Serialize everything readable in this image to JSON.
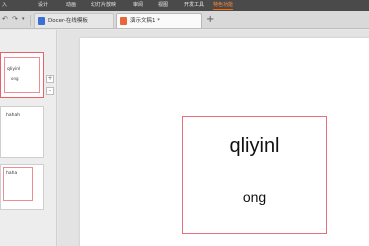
{
  "menu": {
    "items": [
      "入",
      "设计",
      "动画",
      "幻灯片放映",
      "审阅",
      "视图",
      "开发工具",
      "特色功能"
    ],
    "active_index": 7
  },
  "quick_access": [
    "undo-icon",
    "redo-icon",
    "dropdown-icon"
  ],
  "tabs": [
    {
      "label": "Docer-在线模板",
      "icon": "docer-icon",
      "icon_color": "#3b6fd6",
      "active": false
    },
    {
      "label": "演示文稿1 *",
      "icon": "presentation-icon",
      "icon_color": "#e8673a",
      "active": true
    }
  ],
  "tab_add_label": "+",
  "pane": {
    "tab_label": "",
    "slides": [
      {
        "title": "qliyinl",
        "subtitle": "ong",
        "selected": true
      },
      {
        "title": "hahah",
        "subtitle": "",
        "selected": false
      },
      {
        "title": "haha",
        "subtitle": "",
        "selected": false
      }
    ],
    "add_button": "+",
    "more_button": "-"
  },
  "slide": {
    "title": "qliyinl",
    "subtitle": "ong"
  },
  "colors": {
    "menubar": "#4a4a4a",
    "active_menu": "#ff8a3d",
    "placeholder_border": "#e8707a"
  }
}
